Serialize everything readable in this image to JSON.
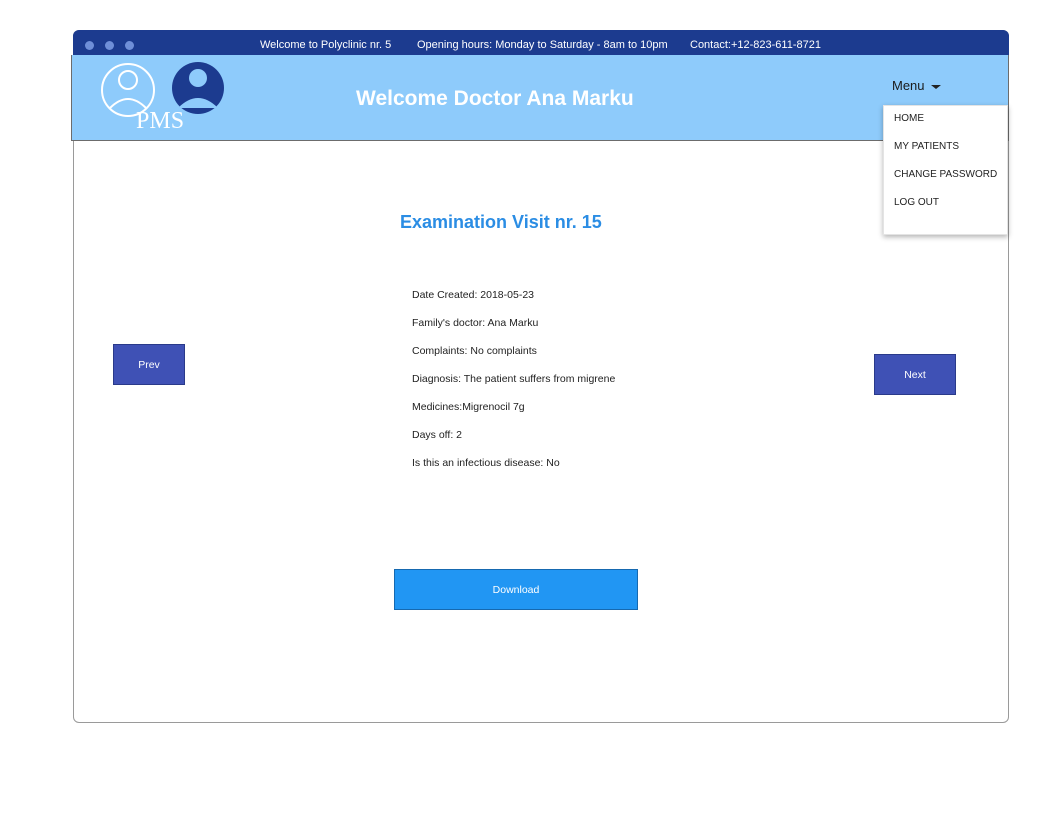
{
  "topbar": {
    "welcome": "Welcome to Polyclinic nr. 5",
    "hours": "Opening hours: Monday to Saturday - 8am to 10pm",
    "contact": "Contact:+12-823-611-8721"
  },
  "header": {
    "logo_text": "PMS",
    "welcome": "Welcome Doctor Ana Marku",
    "menu_label": "Menu"
  },
  "menu": {
    "items": [
      "HOME",
      "MY PATIENTS",
      "CHANGE PASSWORD",
      "LOG OUT"
    ]
  },
  "exam": {
    "title": "Examination Visit nr. 15",
    "fields": [
      "Date Created: 2018-05-23",
      "Family's doctor: Ana Marku",
      "Complaints: No complaints",
      "Diagnosis: The patient suffers from migrene",
      "Medicines:Migrenocil 7g",
      "Days off: 2",
      "Is this an infectious disease: No"
    ]
  },
  "buttons": {
    "prev": "Prev",
    "next": "Next",
    "download": "Download"
  },
  "colors": {
    "topbar": "#1c3b8f",
    "header": "#8ecbfb",
    "title": "#2b8de4",
    "nav_button": "#3f51b5",
    "download_button": "#2196f3"
  }
}
